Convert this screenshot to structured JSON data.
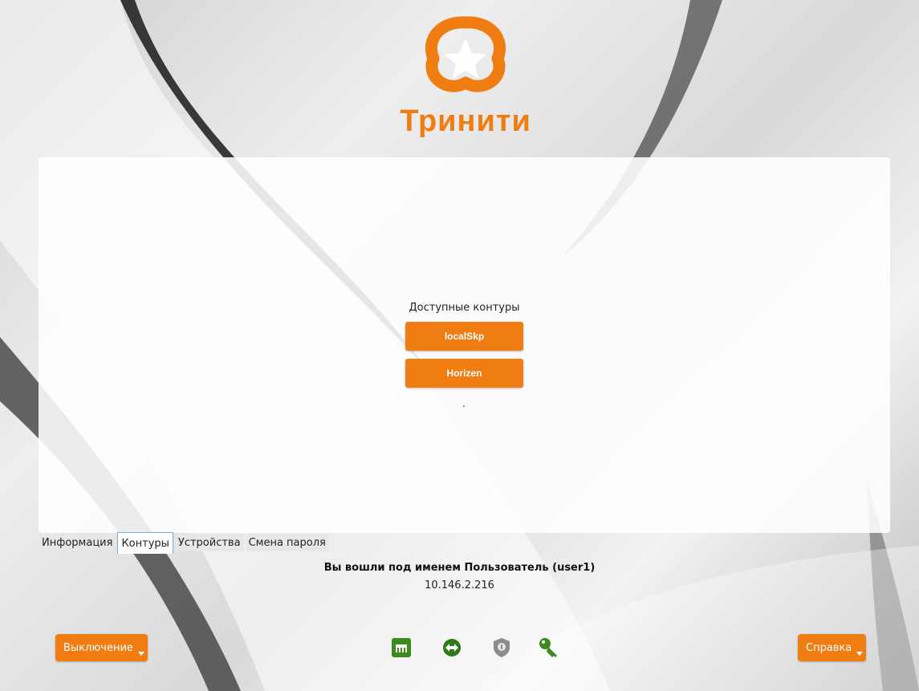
{
  "brand": {
    "name": "Тринити",
    "color": "#ef7d12"
  },
  "panel": {
    "title": "Доступные контуры",
    "contours": [
      "localSkp",
      "Horizen"
    ],
    "footer_mark": "."
  },
  "tabs": [
    {
      "label": "Информация",
      "active": false
    },
    {
      "label": "Контуры",
      "active": true
    },
    {
      "label": "Устройства",
      "active": false
    },
    {
      "label": "Смена пароля",
      "active": false
    }
  ],
  "session": {
    "login_text": "Вы вошли под именем Пользователь  (user1)",
    "ip": "10.146.2.216"
  },
  "buttons": {
    "shutdown": "Выключение",
    "help": "Справка"
  },
  "status_icons": [
    "network-icon",
    "connection-arrows-icon",
    "shield-icon",
    "key-icon"
  ],
  "colors": {
    "accent": "#ef7d12",
    "status_green": "#3d8a1f"
  }
}
